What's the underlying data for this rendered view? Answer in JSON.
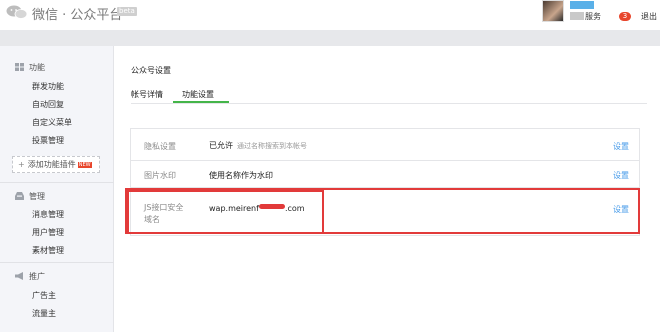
{
  "header": {
    "logo_text": "微信 · 公众平台",
    "beta_badge": "beta",
    "service_label": "服务",
    "notification_count": "3",
    "logout_label": "退出",
    "brand_color": "#44b549"
  },
  "sidebar": {
    "sections": [
      {
        "title": "功能",
        "icon": "grid-icon",
        "items": [
          "群发功能",
          "自动回复",
          "自定义菜单",
          "投票管理"
        ],
        "add_plugin_label": "添加功能插件",
        "new_badge": "NEW"
      },
      {
        "title": "管理",
        "icon": "inbox-icon",
        "items": [
          "消息管理",
          "用户管理",
          "素材管理"
        ]
      },
      {
        "title": "推广",
        "icon": "megaphone-icon",
        "items": [
          "广告主",
          "流量主"
        ]
      }
    ]
  },
  "main": {
    "page_title": "公众号设置",
    "tabs": [
      {
        "label": "帐号详情",
        "active": false
      },
      {
        "label": "功能设置",
        "active": true
      }
    ],
    "settings": [
      {
        "label": "隐私设置",
        "value": "已允许",
        "note": "通过名称搜索到本帐号",
        "action": "设置"
      },
      {
        "label": "图片水印",
        "value": "使用名称作为水印",
        "note": "",
        "action": "设置"
      },
      {
        "label": "JS接口安全域名",
        "value_prefix": "wap.meirenf",
        "value_suffix": ".com",
        "action": "设置"
      }
    ],
    "link_color": "#459ae9",
    "highlight_color": "#e23a3a"
  }
}
